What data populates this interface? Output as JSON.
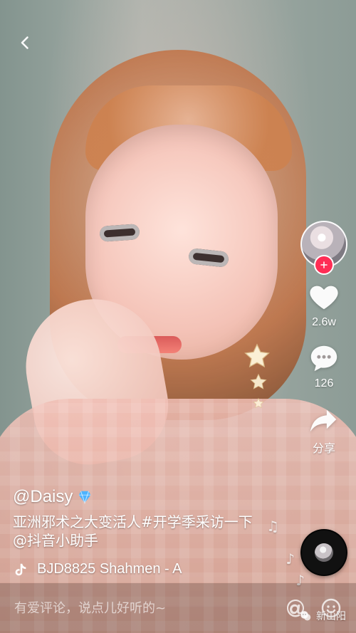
{
  "ui": {
    "back": {
      "icon": "chevron-left-icon"
    },
    "right_actions": {
      "avatar": {
        "icon": "user-avatar-icon",
        "follow_icon": "plus-icon"
      },
      "like": {
        "icon": "heart-icon",
        "count": "2.6w"
      },
      "comment": {
        "icon": "comment-bubble-icon",
        "count": "126"
      },
      "share": {
        "icon": "share-arrow-icon",
        "label": "分享"
      }
    },
    "post": {
      "username": "@Daisy",
      "caption_line1": "亚洲邪术之大变活人#开学季采访一下",
      "caption_line2": "@抖音小助手",
      "music": {
        "icon": "tiktok-note-icon",
        "text": "BJD8825    Shahmen - A"
      }
    },
    "comment_bar": {
      "placeholder": "有爱评论，说点儿好听的~",
      "icons": [
        "at-icon",
        "smile-icon"
      ]
    },
    "watermark": {
      "text": "新山阳"
    },
    "colors": {
      "accent_red": "#ff2d55",
      "white": "#ffffff"
    }
  }
}
